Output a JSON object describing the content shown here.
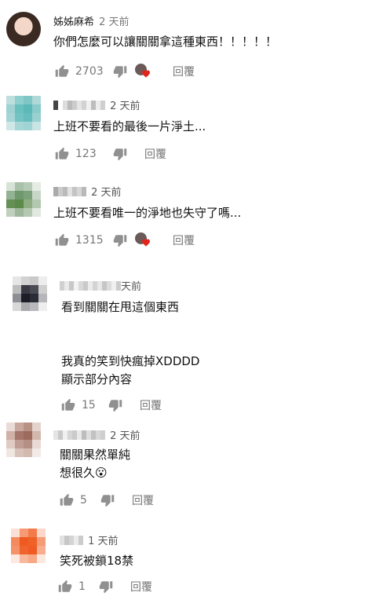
{
  "comments": [
    {
      "author": "姊姊麻希",
      "time": "2 天前",
      "lines": [
        "你們怎麼可以讓關關拿這種東西！！！！！"
      ],
      "likes": "2703",
      "reply": "回覆",
      "creator_heart": true
    },
    {
      "author": "",
      "time": "2 天前",
      "lines": [
        "上班不要看的最後一片淨土..."
      ],
      "likes": "123",
      "reply": "回覆",
      "creator_heart": false
    },
    {
      "author": "",
      "time": "2 天前",
      "lines": [
        "上班不要看唯一的淨地也失守了嗎..."
      ],
      "likes": "1315",
      "reply": "回覆",
      "creator_heart": true
    },
    {
      "author": "",
      "time": "天前",
      "lines": [
        "看到關關在甩這個東西",
        "",
        "",
        "我真的笑到快瘋掉XDDDD"
      ],
      "show_more": "顯示部分內容",
      "likes": "15",
      "reply": "回覆",
      "creator_heart": false
    },
    {
      "author": "",
      "time": "2 天前",
      "lines": [
        "關關果然單純",
        "想很久😮"
      ],
      "likes": "5",
      "reply": "回覆",
      "creator_heart": false
    },
    {
      "author": "",
      "time": "1 天前",
      "lines": [
        "笑死被鎖18禁"
      ],
      "likes": "1",
      "reply": "回覆",
      "creator_heart": false
    }
  ],
  "colors": {
    "icon": "#909090",
    "heart": "#e1251b",
    "text": "#111111",
    "meta": "#777777"
  },
  "icons": {
    "like": "thumbs-up-icon",
    "dislike": "thumbs-down-icon",
    "creator_heart": "heart-icon"
  }
}
